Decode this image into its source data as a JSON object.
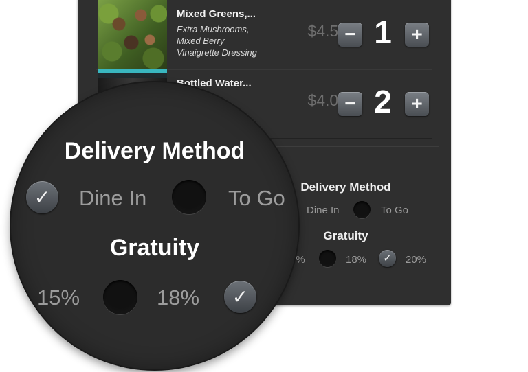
{
  "order_items": [
    {
      "name": "Mixed Greens,...",
      "modifiers": [
        "Extra Mushrooms,",
        "Mixed Berry",
        "Vinaigrette Dressing"
      ],
      "price": "$4.50",
      "quantity": "1",
      "minus_label": "−",
      "plus_label": "+"
    },
    {
      "name": "Bottled Water...",
      "price": "$4.00",
      "quantity": "2",
      "minus_label": "−",
      "plus_label": "+"
    }
  ],
  "delivery": {
    "title": "Delivery Method",
    "options": [
      {
        "label": "Dine In",
        "selected": true
      },
      {
        "label": "To Go",
        "selected": false
      }
    ]
  },
  "gratuity": {
    "title": "Gratuity",
    "options": [
      {
        "label": "15%",
        "selected": false
      },
      {
        "label": "18%",
        "selected": false
      },
      {
        "label": "20%",
        "selected": true
      }
    ],
    "partial_label_panel": "5%"
  },
  "magnifier": {
    "delivery_title": "Delivery Method",
    "dine_in_label": "Dine In",
    "to_go_label": "To Go",
    "gratuity_title": "Gratuity",
    "pct_15_label": "15%",
    "pct_18_label": "18%"
  },
  "check_glyph": "✓",
  "colors": {
    "panel_bg": "#2f2f2f",
    "text_primary": "#f2f2f2",
    "text_muted": "#9a9a9a",
    "button_gray": "#5f6469"
  }
}
